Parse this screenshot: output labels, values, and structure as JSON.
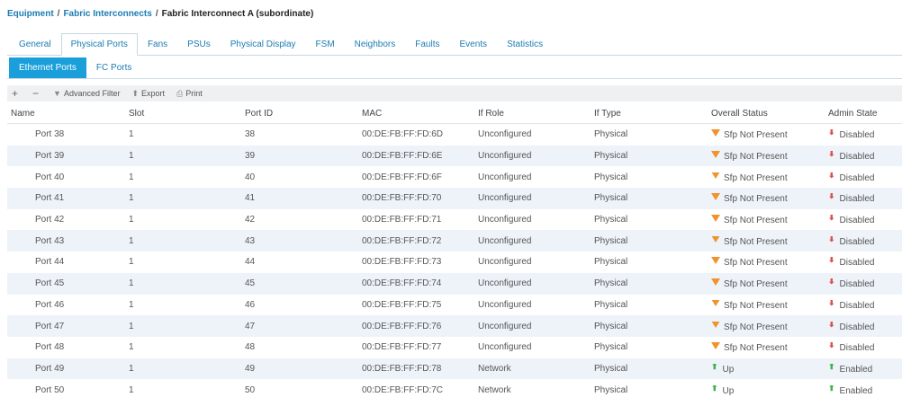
{
  "breadcrumb": {
    "items": [
      "Equipment",
      "Fabric Interconnects"
    ],
    "separator": "/",
    "current": "Fabric Interconnect A (subordinate)"
  },
  "tabs": [
    "General",
    "Physical Ports",
    "Fans",
    "PSUs",
    "Physical Display",
    "FSM",
    "Neighbors",
    "Faults",
    "Events",
    "Statistics"
  ],
  "active_tab": "Physical Ports",
  "subtabs": [
    "Ethernet Ports",
    "FC Ports"
  ],
  "active_subtab": "Ethernet Ports",
  "toolbar": {
    "add_icon": "+",
    "remove_icon": "−",
    "filter_label": "Advanced Filter",
    "export_label": "Export",
    "print_label": "Print"
  },
  "table": {
    "columns": [
      "Name",
      "Slot",
      "Port ID",
      "MAC",
      "If Role",
      "If Type",
      "Overall Status",
      "Admin State"
    ],
    "rows": [
      {
        "name": "Port 38",
        "slot": "1",
        "port_id": "38",
        "mac": "00:DE:FB:FF:FD:6D",
        "if_role": "Unconfigured",
        "if_type": "Physical",
        "status": "Sfp Not Present",
        "status_icon": "warning-icon",
        "admin": "Disabled",
        "admin_icon": "arrow-down-icon"
      },
      {
        "name": "Port 39",
        "slot": "1",
        "port_id": "39",
        "mac": "00:DE:FB:FF:FD:6E",
        "if_role": "Unconfigured",
        "if_type": "Physical",
        "status": "Sfp Not Present",
        "status_icon": "warning-icon",
        "admin": "Disabled",
        "admin_icon": "arrow-down-icon"
      },
      {
        "name": "Port 40",
        "slot": "1",
        "port_id": "40",
        "mac": "00:DE:FB:FF:FD:6F",
        "if_role": "Unconfigured",
        "if_type": "Physical",
        "status": "Sfp Not Present",
        "status_icon": "warning-icon",
        "admin": "Disabled",
        "admin_icon": "arrow-down-icon"
      },
      {
        "name": "Port 41",
        "slot": "1",
        "port_id": "41",
        "mac": "00:DE:FB:FF:FD:70",
        "if_role": "Unconfigured",
        "if_type": "Physical",
        "status": "Sfp Not Present",
        "status_icon": "warning-icon",
        "admin": "Disabled",
        "admin_icon": "arrow-down-icon"
      },
      {
        "name": "Port 42",
        "slot": "1",
        "port_id": "42",
        "mac": "00:DE:FB:FF:FD:71",
        "if_role": "Unconfigured",
        "if_type": "Physical",
        "status": "Sfp Not Present",
        "status_icon": "warning-icon",
        "admin": "Disabled",
        "admin_icon": "arrow-down-icon"
      },
      {
        "name": "Port 43",
        "slot": "1",
        "port_id": "43",
        "mac": "00:DE:FB:FF:FD:72",
        "if_role": "Unconfigured",
        "if_type": "Physical",
        "status": "Sfp Not Present",
        "status_icon": "warning-icon",
        "admin": "Disabled",
        "admin_icon": "arrow-down-icon"
      },
      {
        "name": "Port 44",
        "slot": "1",
        "port_id": "44",
        "mac": "00:DE:FB:FF:FD:73",
        "if_role": "Unconfigured",
        "if_type": "Physical",
        "status": "Sfp Not Present",
        "status_icon": "warning-icon",
        "admin": "Disabled",
        "admin_icon": "arrow-down-icon"
      },
      {
        "name": "Port 45",
        "slot": "1",
        "port_id": "45",
        "mac": "00:DE:FB:FF:FD:74",
        "if_role": "Unconfigured",
        "if_type": "Physical",
        "status": "Sfp Not Present",
        "status_icon": "warning-icon",
        "admin": "Disabled",
        "admin_icon": "arrow-down-icon"
      },
      {
        "name": "Port 46",
        "slot": "1",
        "port_id": "46",
        "mac": "00:DE:FB:FF:FD:75",
        "if_role": "Unconfigured",
        "if_type": "Physical",
        "status": "Sfp Not Present",
        "status_icon": "warning-icon",
        "admin": "Disabled",
        "admin_icon": "arrow-down-icon"
      },
      {
        "name": "Port 47",
        "slot": "1",
        "port_id": "47",
        "mac": "00:DE:FB:FF:FD:76",
        "if_role": "Unconfigured",
        "if_type": "Physical",
        "status": "Sfp Not Present",
        "status_icon": "warning-icon",
        "admin": "Disabled",
        "admin_icon": "arrow-down-icon"
      },
      {
        "name": "Port 48",
        "slot": "1",
        "port_id": "48",
        "mac": "00:DE:FB:FF:FD:77",
        "if_role": "Unconfigured",
        "if_type": "Physical",
        "status": "Sfp Not Present",
        "status_icon": "warning-icon",
        "admin": "Disabled",
        "admin_icon": "arrow-down-icon"
      },
      {
        "name": "Port 49",
        "slot": "1",
        "port_id": "49",
        "mac": "00:DE:FB:FF:FD:78",
        "if_role": "Network",
        "if_type": "Physical",
        "status": "Up",
        "status_icon": "arrow-up-icon",
        "admin": "Enabled",
        "admin_icon": "arrow-up-icon"
      },
      {
        "name": "Port 50",
        "slot": "1",
        "port_id": "50",
        "mac": "00:DE:FB:FF:FD:7C",
        "if_role": "Network",
        "if_type": "Physical",
        "status": "Up",
        "status_icon": "arrow-up-icon",
        "admin": "Enabled",
        "admin_icon": "arrow-up-icon"
      }
    ]
  },
  "colors": {
    "link": "#1b7cb3",
    "active_subtab": "#1a9fdb",
    "row_alt": "#eef3fa",
    "warning": "#f0932b",
    "disabled": "#d9534f",
    "enabled": "#3cb44b"
  }
}
